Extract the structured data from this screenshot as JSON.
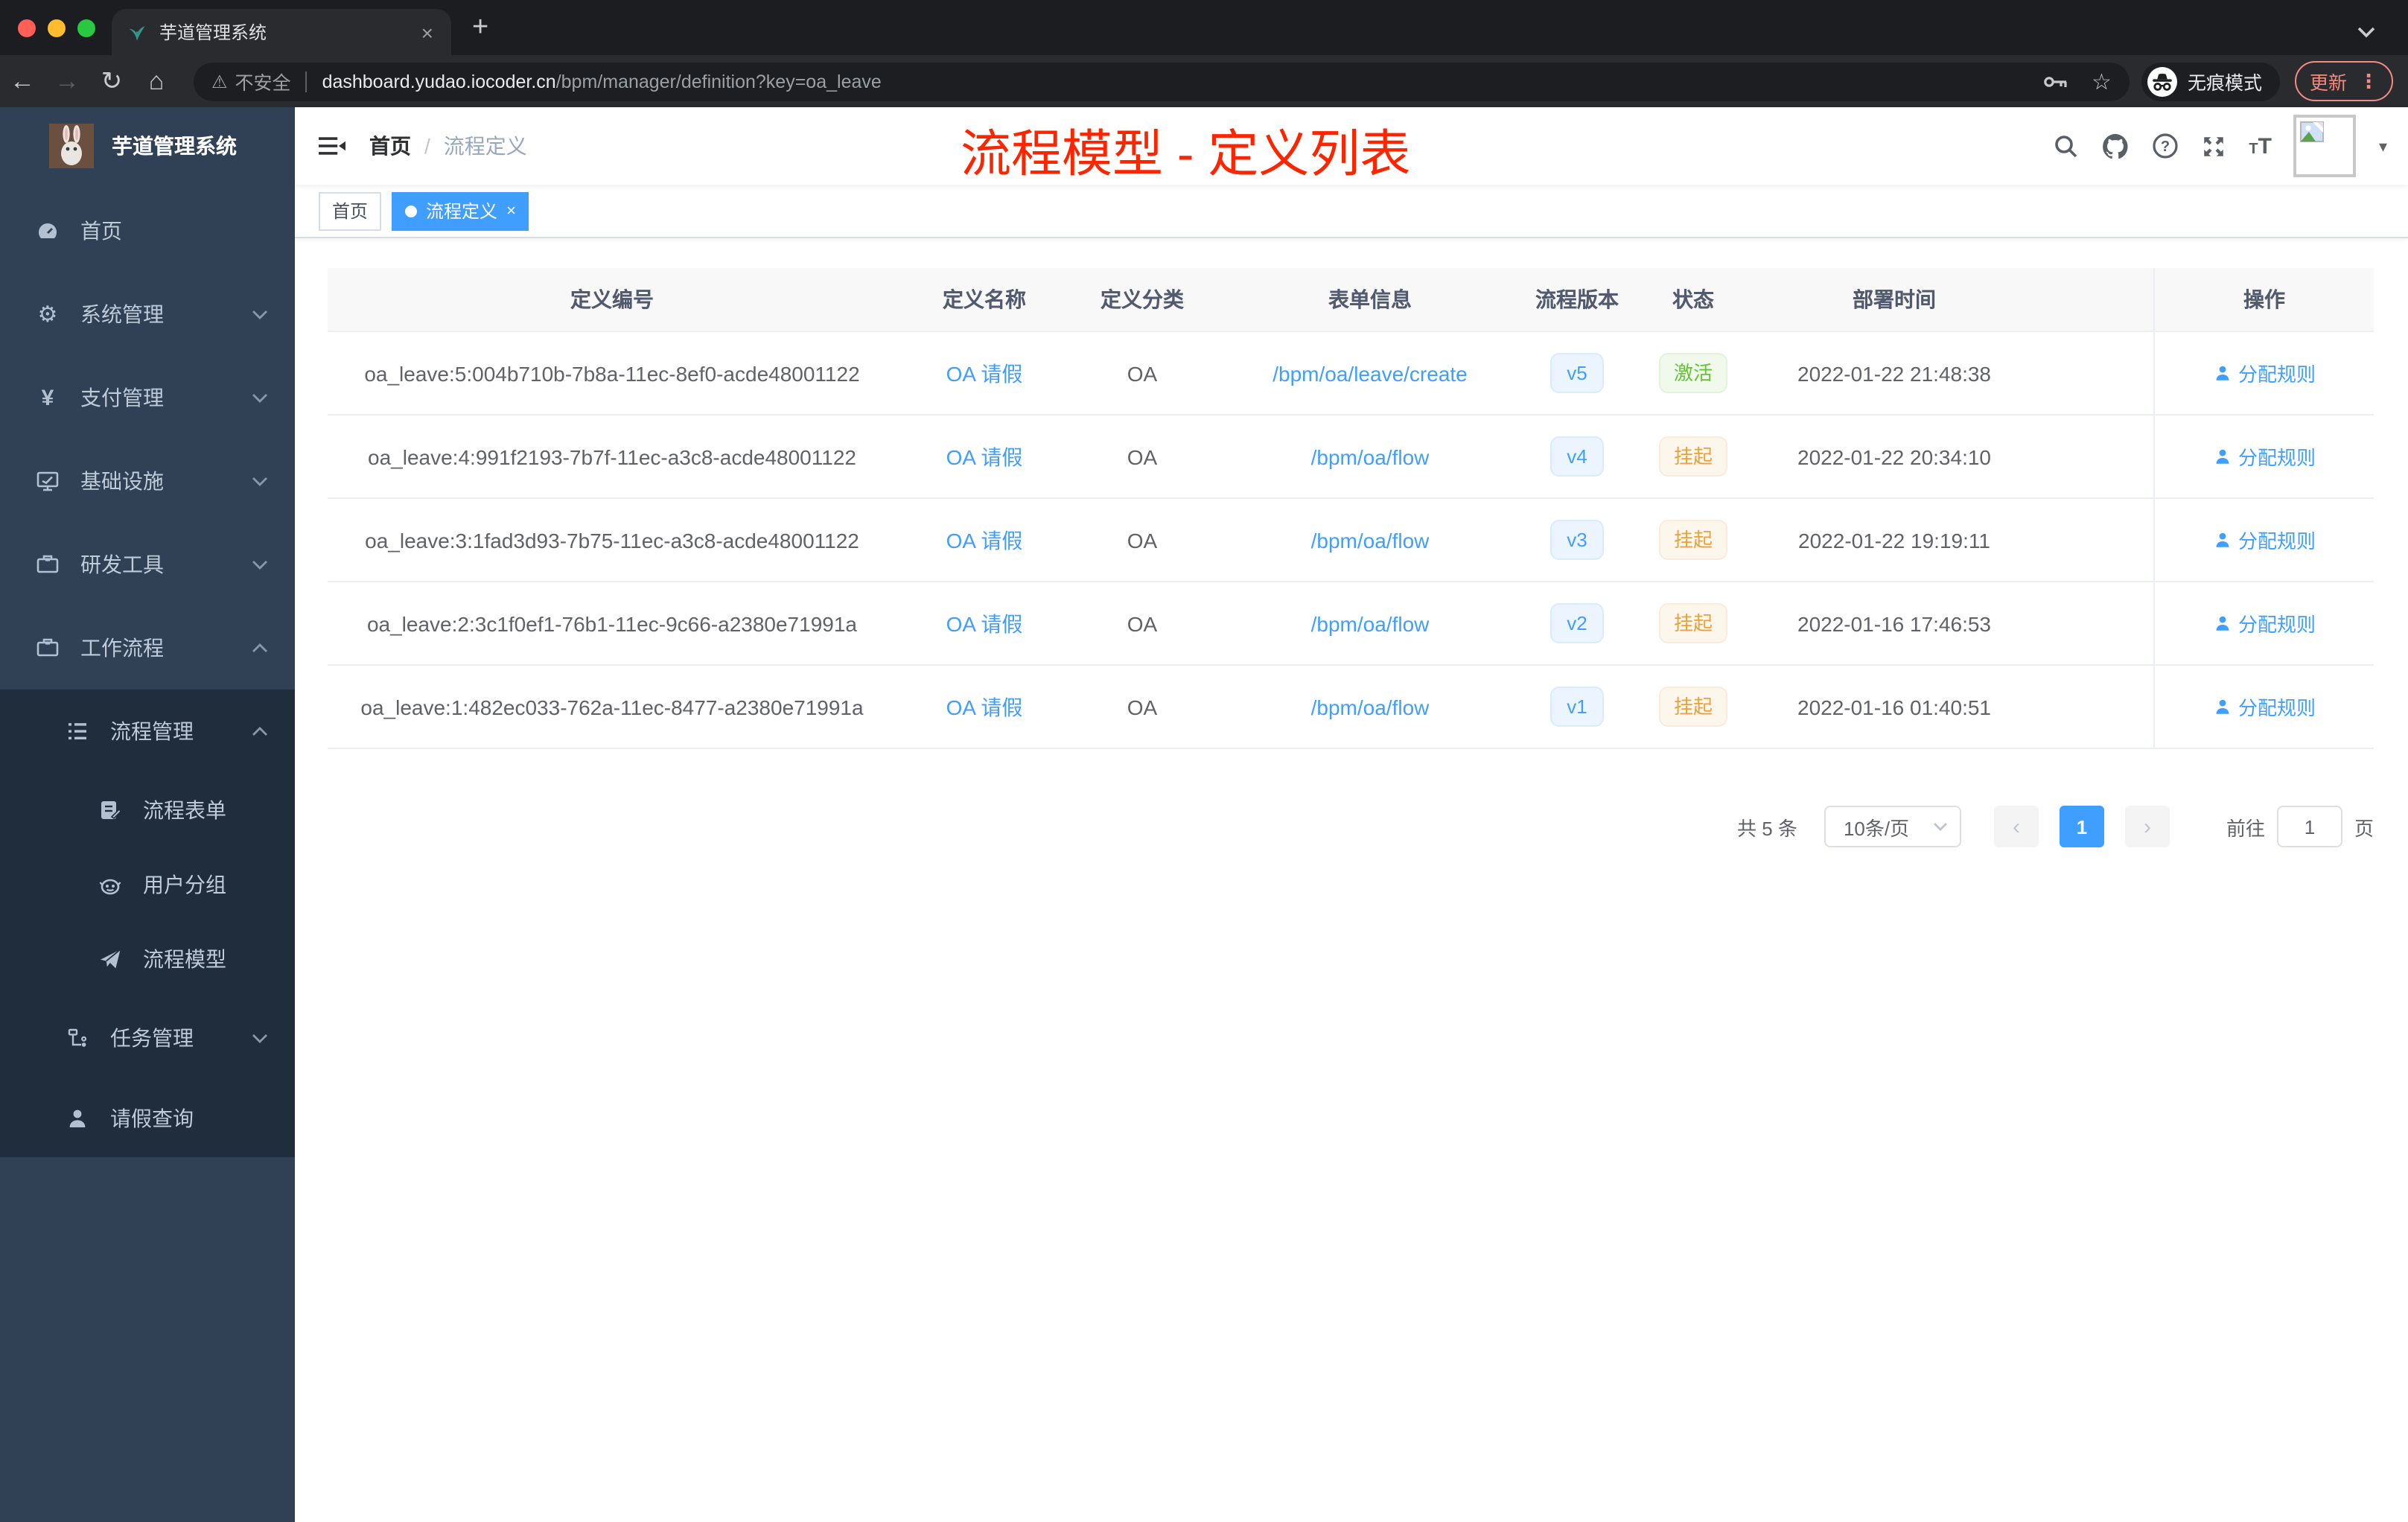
{
  "browser": {
    "tab": {
      "title": "芋道管理系统"
    },
    "toolbar": {
      "security_label": "不安全",
      "url_host": "dashboard.yudao.iocoder.cn",
      "url_path": "/bpm/manager/definition?key=oa_leave",
      "incognito_label": "无痕模式",
      "update_label": "更新"
    }
  },
  "icons": {
    "back": "←",
    "forward": "→",
    "reload": "↻",
    "home": "⌂",
    "star": "☆",
    "more": "⋮",
    "close": "×",
    "new_tab": "+",
    "warning": "⚠",
    "caret_down": "▾",
    "prev": "‹",
    "next": "›",
    "yen": "¥",
    "gear": "⚙"
  },
  "sidebar": {
    "logo_title": "芋道管理系统",
    "menu": [
      {
        "label": "首页",
        "icon": "dashboard-icon",
        "expandable": false
      },
      {
        "label": "系统管理",
        "icon": "gear-icon",
        "expandable": true,
        "expanded": false
      },
      {
        "label": "支付管理",
        "icon": "yen-icon",
        "expandable": true,
        "expanded": false
      },
      {
        "label": "基础设施",
        "icon": "monitor-icon",
        "expandable": true,
        "expanded": false
      },
      {
        "label": "研发工具",
        "icon": "toolbox-icon",
        "expandable": true,
        "expanded": false
      },
      {
        "label": "工作流程",
        "icon": "toolbox-icon",
        "expandable": true,
        "expanded": true
      }
    ],
    "submenu": [
      {
        "label": "流程管理",
        "icon": "tree-icon",
        "level": 1,
        "expandable": true,
        "expanded": true
      },
      {
        "label": "流程表单",
        "icon": "form-icon",
        "level": 2
      },
      {
        "label": "用户分组",
        "icon": "usergroup-icon",
        "level": 2
      },
      {
        "label": "流程模型",
        "icon": "send-icon",
        "level": 2
      },
      {
        "label": "任务管理",
        "icon": "tree-icon",
        "level": 1,
        "expandable": true,
        "expanded": false
      },
      {
        "label": "请假查询",
        "icon": "user-icon",
        "level": 1
      }
    ]
  },
  "header": {
    "breadcrumb_home": "首页",
    "breadcrumb_sep": "/",
    "breadcrumb_current": "流程定义",
    "overlay_title": "流程模型 - 定义列表"
  },
  "tags": {
    "items": [
      {
        "label": "首页",
        "active": false
      },
      {
        "label": "流程定义",
        "active": true,
        "closable": true
      }
    ]
  },
  "table": {
    "columns": [
      "定义编号",
      "定义名称",
      "定义分类",
      "表单信息",
      "流程版本",
      "状态",
      "部署时间",
      "操作"
    ],
    "rows": [
      {
        "id": "oa_leave:5:004b710b-7b8a-11ec-8ef0-acde48001122",
        "name": "OA 请假",
        "category": "OA",
        "form": "/bpm/oa/leave/create",
        "version": "v5",
        "status": "激活",
        "status_type": "success",
        "deploy_time": "2022-01-22 21:48:38",
        "action": "分配规则"
      },
      {
        "id": "oa_leave:4:991f2193-7b7f-11ec-a3c8-acde48001122",
        "name": "OA 请假",
        "category": "OA",
        "form": "/bpm/oa/flow",
        "version": "v4",
        "status": "挂起",
        "status_type": "warning",
        "deploy_time": "2022-01-22 20:34:10",
        "action": "分配规则"
      },
      {
        "id": "oa_leave:3:1fad3d93-7b75-11ec-a3c8-acde48001122",
        "name": "OA 请假",
        "category": "OA",
        "form": "/bpm/oa/flow",
        "version": "v3",
        "status": "挂起",
        "status_type": "warning",
        "deploy_time": "2022-01-22 19:19:11",
        "action": "分配规则"
      },
      {
        "id": "oa_leave:2:3c1f0ef1-76b1-11ec-9c66-a2380e71991a",
        "name": "OA 请假",
        "category": "OA",
        "form": "/bpm/oa/flow",
        "version": "v2",
        "status": "挂起",
        "status_type": "warning",
        "deploy_time": "2022-01-16 17:46:53",
        "action": "分配规则"
      },
      {
        "id": "oa_leave:1:482ec033-762a-11ec-8477-a2380e71991a",
        "name": "OA 请假",
        "category": "OA",
        "form": "/bpm/oa/flow",
        "version": "v1",
        "status": "挂起",
        "status_type": "warning",
        "deploy_time": "2022-01-16 01:40:51",
        "action": "分配规则"
      }
    ]
  },
  "pagination": {
    "total_label": "共 5 条",
    "page_size": "10条/页",
    "current_page": "1",
    "goto_label": "前往",
    "goto_value": "1",
    "page_unit": "页"
  },
  "colors": {
    "accent": "#409eff",
    "success": "#67c23a",
    "warning": "#e6a23c",
    "sidebar_bg": "#304156",
    "submenu_bg": "#1f2d3d",
    "annotation_red": "#fb2500"
  }
}
